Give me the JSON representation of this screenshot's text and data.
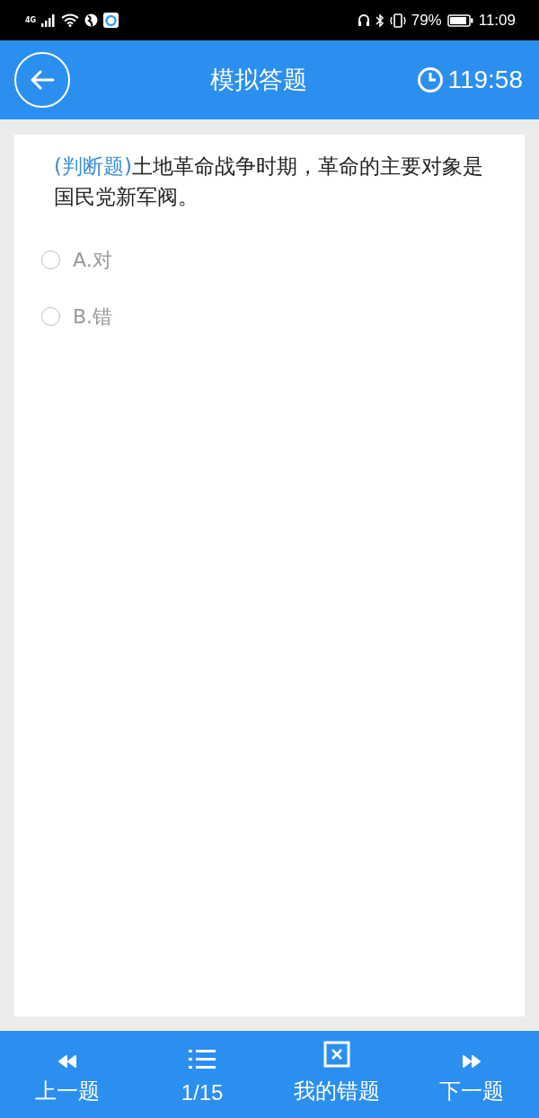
{
  "status_bar": {
    "network": "4G",
    "battery_percent": "79%",
    "time": "11:09"
  },
  "header": {
    "title": "模拟答题",
    "timer": "119:58"
  },
  "question": {
    "type": "(判断题)",
    "text": "土地革命战争时期，革命的主要对象是国民党新军阀。"
  },
  "options": [
    {
      "label": "A.对",
      "selected": false
    },
    {
      "label": "B.错",
      "selected": false
    }
  ],
  "bottom_nav": [
    {
      "kind": "prev",
      "label": "上一题"
    },
    {
      "kind": "list",
      "label": "1/15"
    },
    {
      "kind": "wrong",
      "label": "我的错题"
    },
    {
      "kind": "next",
      "label": "下一题"
    }
  ]
}
